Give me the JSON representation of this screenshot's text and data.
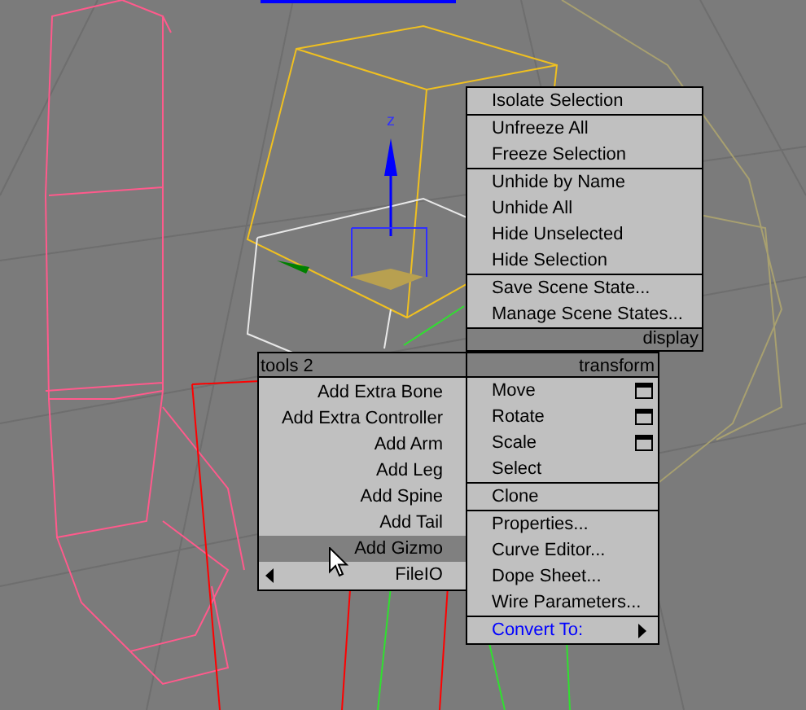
{
  "viewport": {
    "gizmo_axis_label": "z"
  },
  "display_menu": {
    "title": "display",
    "groups": [
      [
        {
          "label": "Isolate Selection",
          "kind": "plain"
        }
      ],
      [
        {
          "label": "Unfreeze All",
          "kind": "plain"
        },
        {
          "label": "Freeze Selection",
          "kind": "plain"
        }
      ],
      [
        {
          "label": "Unhide by Name",
          "kind": "plain"
        },
        {
          "label": "Unhide All",
          "kind": "plain"
        },
        {
          "label": "Hide Unselected",
          "kind": "plain"
        },
        {
          "label": "Hide Selection",
          "kind": "plain"
        }
      ],
      [
        {
          "label": "Save Scene State...",
          "kind": "plain"
        },
        {
          "label": "Manage Scene States...",
          "kind": "plain"
        }
      ]
    ]
  },
  "tools_menu": {
    "title": "tools 2",
    "items": [
      {
        "label": "Add Extra Bone",
        "selected": false,
        "kind": "plain"
      },
      {
        "label": "Add Extra Controller",
        "selected": false,
        "kind": "plain"
      },
      {
        "label": "Add Arm",
        "selected": false,
        "kind": "plain"
      },
      {
        "label": "Add Leg",
        "selected": false,
        "kind": "plain"
      },
      {
        "label": "Add Spine",
        "selected": false,
        "kind": "plain"
      },
      {
        "label": "Add Tail",
        "selected": false,
        "kind": "plain"
      },
      {
        "label": "Add Gizmo",
        "selected": true,
        "kind": "plain"
      },
      {
        "label": "FileIO",
        "selected": false,
        "kind": "submenu"
      }
    ]
  },
  "transform_menu": {
    "title": "transform",
    "groups": [
      [
        {
          "label": "Move",
          "kind": "option"
        },
        {
          "label": "Rotate",
          "kind": "option"
        },
        {
          "label": "Scale",
          "kind": "option"
        },
        {
          "label": "Select",
          "kind": "plain"
        }
      ],
      [
        {
          "label": "Clone",
          "kind": "plain"
        }
      ],
      [
        {
          "label": "Properties...",
          "kind": "plain"
        },
        {
          "label": "Curve Editor...",
          "kind": "plain"
        },
        {
          "label": "Dope Sheet...",
          "kind": "plain"
        },
        {
          "label": "Wire Parameters...",
          "kind": "plain"
        }
      ],
      [
        {
          "label": "Convert To:",
          "kind": "submenu"
        }
      ]
    ]
  }
}
